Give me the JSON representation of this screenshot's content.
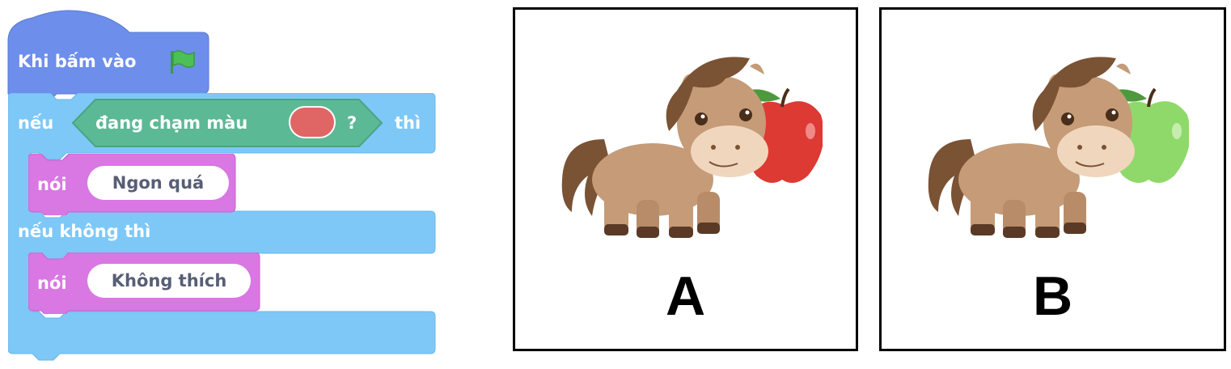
{
  "script": {
    "hat_label": "Khi bấm vào",
    "if_label": "nếu",
    "sensing_label": "đang chạm màu",
    "sensing_question": "?",
    "then_label": "thì",
    "say1_label": "nói",
    "say1_text": "Ngon quá",
    "else_label": "nếu không thì",
    "say2_label": "nói",
    "say2_text": "Không thích",
    "touch_color": "#e06666"
  },
  "colors": {
    "events": "#6d8eea",
    "control": "#7ec8f8",
    "sensing": "#5cb995",
    "looks": "#d977e3",
    "flag": "#4cbf56",
    "apple_red": "#dc3a33",
    "apple_green": "#8fd96a"
  },
  "cards": [
    {
      "letter": "A",
      "apple": "red",
      "icon": "horse-with-red-apple"
    },
    {
      "letter": "B",
      "apple": "green",
      "icon": "horse-with-green-apple"
    }
  ]
}
